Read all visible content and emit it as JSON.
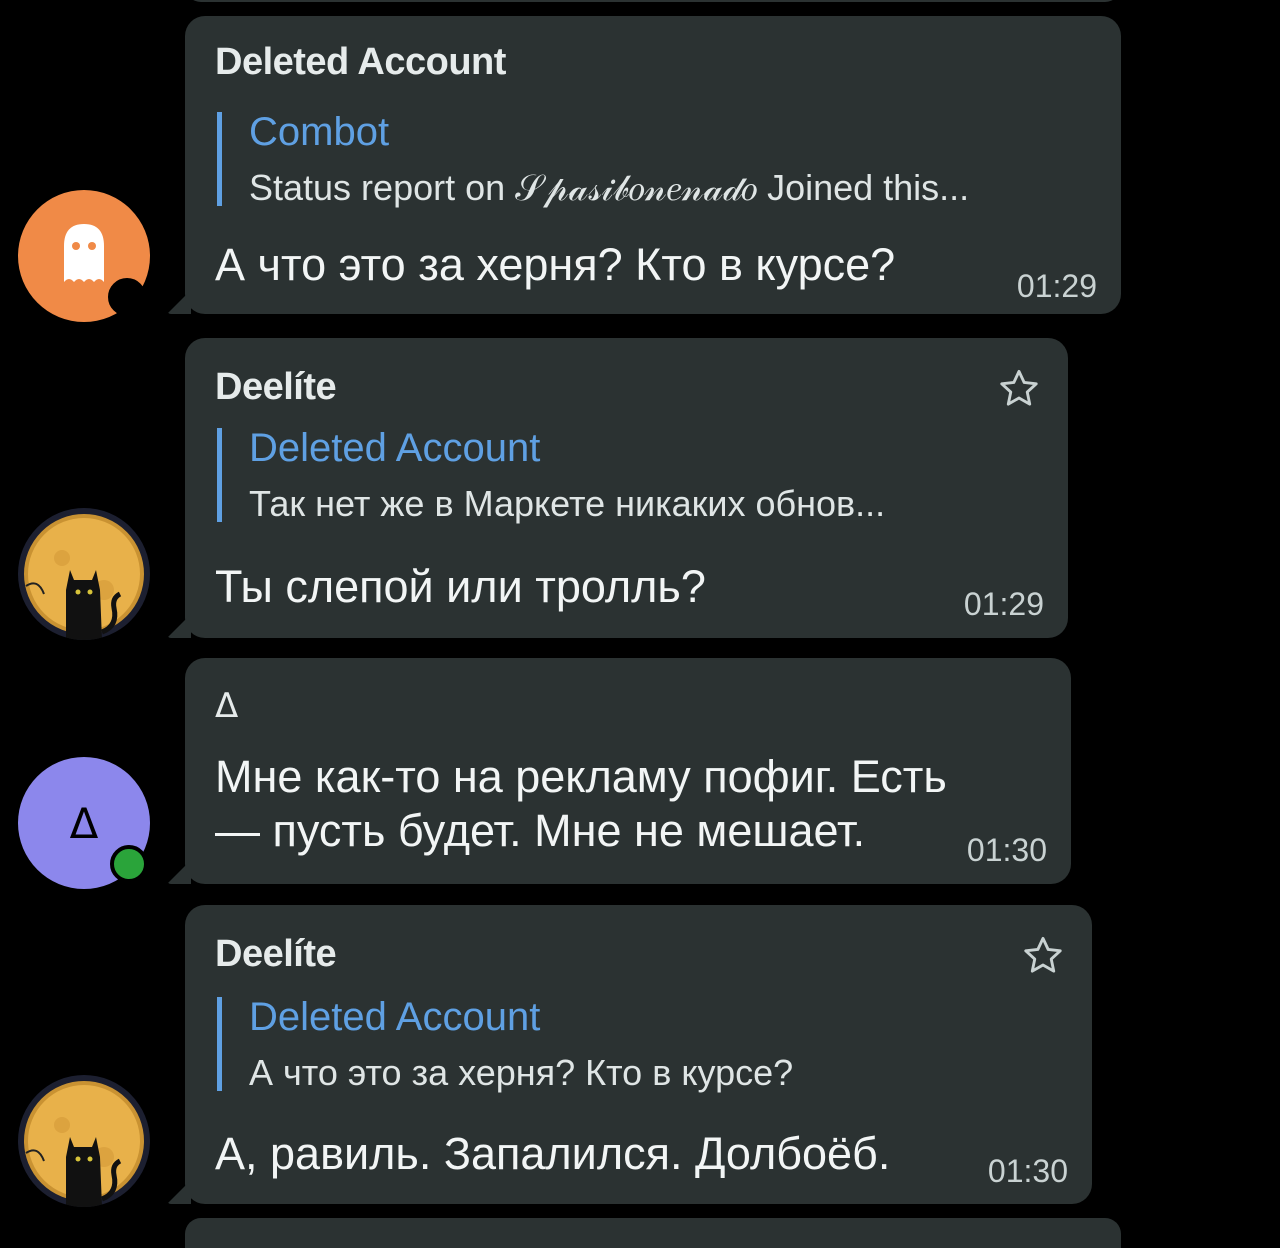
{
  "messages": [
    {
      "sender": "Deleted Account",
      "reply_name": "Combot",
      "reply_text": "Status report on 𝒮𝓅𝒶𝓈𝒾𝒷𝑜𝓃𝑒𝓃𝒶𝒹𝑜 Joined this...",
      "text": "А что это за херня? Кто в курсе?",
      "time": "01:29",
      "avatar": "ghost-icon"
    },
    {
      "sender": "Deelíte",
      "reply_name": "Deleted Account",
      "reply_text": "Так нет же в Маркете никаких обнов...",
      "text": "Ты слепой или тролль?",
      "time": "01:29",
      "avatar": "cat-moon-avatar"
    },
    {
      "sender": "Δ",
      "text_line1": "Мне как-то на рекламу пофиг. Есть",
      "text_line2": "— пусть будет. Мне не мешает.",
      "time": "01:30",
      "avatar_letter": "Δ"
    },
    {
      "sender": "Deelíte",
      "reply_name": "Deleted Account",
      "reply_text": "А что это за херня? Кто в курсе?",
      "text": "А, равиль. Запалился. Долбоёб.",
      "time": "01:30",
      "avatar": "cat-moon-avatar"
    }
  ],
  "colors": {
    "background": "#000000",
    "bubble": "#2b3232",
    "accent": "#5fa0e3",
    "ghost_avatar": "#f08a47",
    "delta_avatar": "#8c87ec",
    "online_dot": "#2aa43a"
  }
}
